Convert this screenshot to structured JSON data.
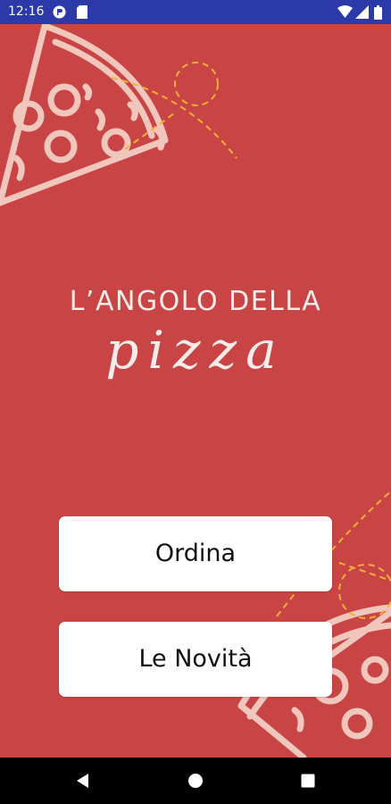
{
  "status_bar": {
    "time": "12:16",
    "background": "#2b3aa8",
    "icons": [
      "notification-app-icon",
      "sim-card-icon",
      "wifi-icon",
      "signal-icon",
      "battery-icon"
    ]
  },
  "logo": {
    "line1": "L’ANGOLO DELLA",
    "line2": "pizza"
  },
  "buttons": {
    "ordina": "Ordina",
    "novita": "Le Novità"
  },
  "nav_bar": {
    "icons": [
      "back-icon",
      "home-icon",
      "recents-icon"
    ]
  },
  "colors": {
    "background": "#c94545",
    "button": "#ffffff",
    "decoration_line": "#f1c7bd",
    "decoration_dash": "#f2b134"
  }
}
